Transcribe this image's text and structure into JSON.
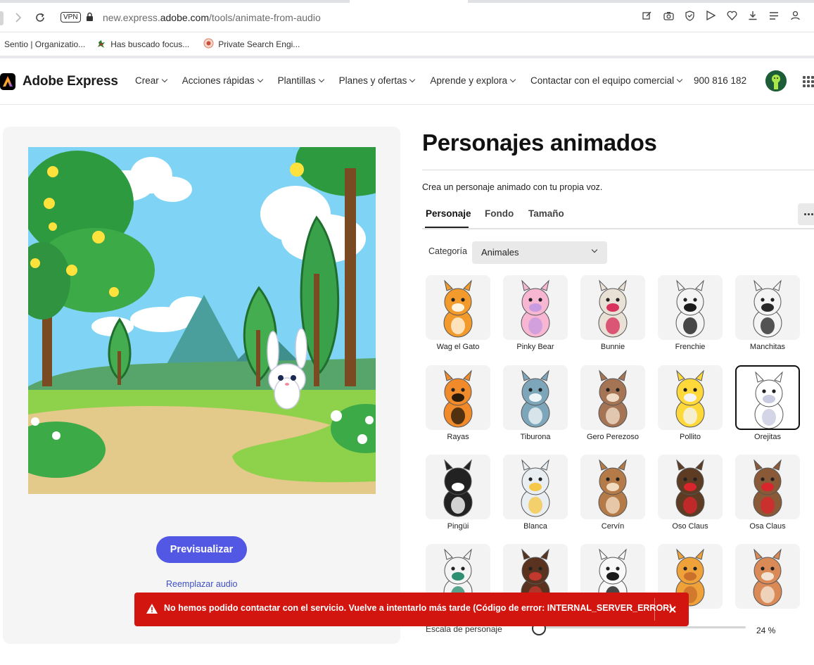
{
  "browser": {
    "vpn_label": "VPN",
    "url_prefix": "new.express.",
    "url_domain": "adobe.com",
    "url_path": "/tools/animate-from-audio",
    "toolbar_icons": [
      "edit-icon",
      "camera-icon",
      "shield-icon",
      "send-icon",
      "heart-icon",
      "download-icon",
      "playlist-icon",
      "profile-icon"
    ],
    "bookmarks": [
      {
        "label": "Sentio | Organizatio..."
      },
      {
        "label": "Has buscado focus..."
      },
      {
        "label": "Private Search Engi..."
      }
    ]
  },
  "header": {
    "brand": "Adobe Express",
    "menu": [
      {
        "label": "Crear"
      },
      {
        "label": "Acciones rápidas"
      },
      {
        "label": "Plantillas"
      },
      {
        "label": "Planes y ofertas"
      },
      {
        "label": "Aprende y explora"
      },
      {
        "label": "Contactar con el equipo comercial"
      }
    ],
    "phone": "900 816 182"
  },
  "preview": {
    "button_label": "Previsualizar",
    "replace_audio_label": "Reemplazar audio"
  },
  "panel": {
    "title": "Personajes animados",
    "subtitle": "Crea un personaje animado con tu propia voz.",
    "tabs": [
      {
        "label": "Personaje"
      },
      {
        "label": "Fondo"
      },
      {
        "label": "Tamaño"
      }
    ],
    "active_tab": "Personaje",
    "category_label": "Categoría",
    "category_value": "Animales",
    "characters": [
      {
        "name": "Wag el Gato",
        "icon": "orange-cat-icon"
      },
      {
        "name": "Pinky Bear",
        "icon": "pink-bear-icon"
      },
      {
        "name": "Bunnie",
        "icon": "bunny-icon"
      },
      {
        "name": "Frenchie",
        "icon": "french-bulldog-icon"
      },
      {
        "name": "Manchitas",
        "icon": "spotted-leopard-icon"
      },
      {
        "name": "Rayas",
        "icon": "tiger-icon"
      },
      {
        "name": "Tiburona",
        "icon": "shark-icon"
      },
      {
        "name": "Gero Perezoso",
        "icon": "sloth-icon"
      },
      {
        "name": "Pollito",
        "icon": "chick-icon"
      },
      {
        "name": "Orejitas",
        "icon": "white-rabbit-icon",
        "selected": true
      },
      {
        "name": "Pingüi",
        "icon": "penguin-icon"
      },
      {
        "name": "Blanca",
        "icon": "owl-icon"
      },
      {
        "name": "Cervín",
        "icon": "deer-icon"
      },
      {
        "name": "Oso Claus",
        "icon": "santa-bear-icon"
      },
      {
        "name": "Osa Claus",
        "icon": "mrs-claus-bear-icon"
      },
      {
        "name": "",
        "icon": "polar-bear-icon"
      },
      {
        "name": "",
        "icon": "brown-bear-scarf-icon"
      },
      {
        "name": "",
        "icon": "panda-icon"
      },
      {
        "name": "",
        "icon": "lion-icon"
      },
      {
        "name": "",
        "icon": "fox-icon"
      }
    ],
    "scale_label": "Escala de personaje",
    "scale_value": "24 %",
    "scale_level": 0.0
  },
  "toast": {
    "message": "No hemos podido contactar con el servicio. Vuelve a intentarlo más tarde (Código de error: INTERNAL_SERVER_ERROR)",
    "color": "#d31510"
  },
  "colors": {
    "accent": "#5258e4",
    "link": "#3e4fc7",
    "error": "#d31510"
  }
}
